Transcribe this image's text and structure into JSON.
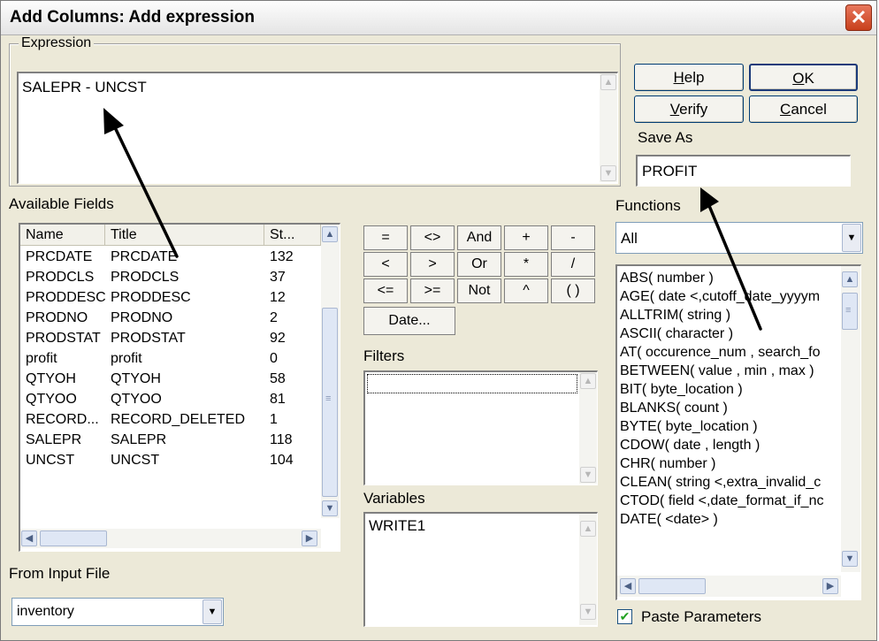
{
  "window": {
    "title": "Add Columns: Add expression",
    "close_glyph": "✕"
  },
  "expression": {
    "group_label": "Expression",
    "value": "SALEPR - UNCST"
  },
  "buttons": {
    "help": "Help",
    "help_underline": "H",
    "help_rest": "elp",
    "ok": "OK",
    "ok_underline": "O",
    "ok_rest": "K",
    "verify": "Verify",
    "verify_underline": "V",
    "verify_rest": "erify",
    "cancel": "Cancel",
    "cancel_underline": "C",
    "cancel_rest": "ancel"
  },
  "save_as": {
    "label": "Save As",
    "value": "PROFIT"
  },
  "available_fields": {
    "label": "Available Fields",
    "columns": [
      "Name",
      "Title",
      "St..."
    ],
    "rows": [
      {
        "name": "PRCDATE",
        "title": "PRCDATE",
        "st": "132"
      },
      {
        "name": "PRODCLS",
        "title": "PRODCLS",
        "st": "37"
      },
      {
        "name": "PRODDESC",
        "title": "PRODDESC",
        "st": "12"
      },
      {
        "name": "PRODNO",
        "title": "PRODNO",
        "st": "2"
      },
      {
        "name": "PRODSTAT",
        "title": "PRODSTAT",
        "st": "92"
      },
      {
        "name": "profit",
        "title": "profit",
        "st": "0"
      },
      {
        "name": "QTYOH",
        "title": "QTYOH",
        "st": "58"
      },
      {
        "name": "QTYOO",
        "title": "QTYOO",
        "st": "81"
      },
      {
        "name": "RECORD...",
        "title": "RECORD_DELETED",
        "st": "1"
      },
      {
        "name": "SALEPR",
        "title": "SALEPR",
        "st": "118"
      },
      {
        "name": "UNCST",
        "title": "UNCST",
        "st": "104"
      }
    ]
  },
  "from_input_file": {
    "label": "From Input File",
    "value": "inventory"
  },
  "operators": {
    "row1": [
      "=",
      "<>",
      "And",
      "+",
      "-"
    ],
    "row2": [
      "<",
      ">",
      "Or",
      "*",
      "/"
    ],
    "row3": [
      "<=",
      ">=",
      "Not",
      "^",
      "( )"
    ],
    "date": "Date..."
  },
  "filters": {
    "label": "Filters",
    "items": [
      ""
    ]
  },
  "variables": {
    "label": "Variables",
    "items": [
      "WRITE1"
    ]
  },
  "functions": {
    "label": "Functions",
    "category": "All",
    "items": [
      "ABS( number )",
      "AGE( date <,cutoff_date_yyyym",
      "ALLTRIM( string )",
      "ASCII( character )",
      "AT( occurence_num , search_fo",
      "BETWEEN( value , min , max )",
      "BIT( byte_location )",
      "BLANKS( count )",
      "BYTE( byte_location )",
      "CDOW( date , length )",
      "CHR( number )",
      "CLEAN( string <,extra_invalid_c",
      "CTOD( field <,date_format_if_nc",
      "DATE( <date> )"
    ],
    "paste_parameters": "Paste Parameters",
    "paste_checked": true
  },
  "icons": {
    "up": "▲",
    "down": "▼",
    "left": "◀",
    "right": "▶",
    "check": "✔",
    "grip": "≡"
  }
}
